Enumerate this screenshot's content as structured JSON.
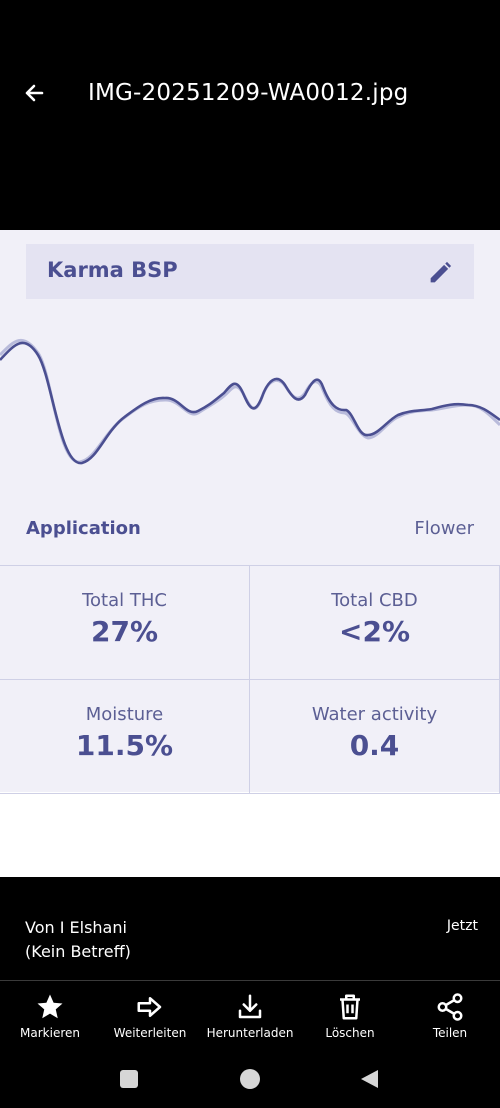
{
  "header": {
    "filename": "IMG-20251209-WA0012.jpg"
  },
  "photo": {
    "strain_name": "Karma BSP",
    "application_label": "Application",
    "application_value": "Flower",
    "metrics": [
      {
        "label": "Total THC",
        "value": "27%"
      },
      {
        "label": "Total CBD",
        "value": "<2%"
      },
      {
        "label": "Moisture",
        "value": "11.5%"
      },
      {
        "label": "Water activity",
        "value": "0.4"
      }
    ],
    "colors": {
      "accent": "#4b4f91",
      "background": "#f1f0f8"
    }
  },
  "message": {
    "sender": "Von I Elshani",
    "subject": "(Kein Betreff)",
    "time": "Jetzt"
  },
  "actions": [
    {
      "label": "Markieren",
      "icon": "star-icon"
    },
    {
      "label": "Weiterleiten",
      "icon": "forward-icon"
    },
    {
      "label": "Herunterladen",
      "icon": "download-icon"
    },
    {
      "label": "Löschen",
      "icon": "trash-icon"
    },
    {
      "label": "Teilen",
      "icon": "share-icon"
    }
  ],
  "system_nav": [
    "recents-button",
    "home-button",
    "back-nav-button"
  ]
}
